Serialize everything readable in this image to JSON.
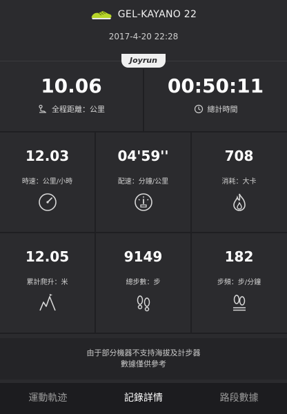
{
  "header": {
    "title": "GEL-KAYANO 22",
    "date": "2017-4-20 22:28",
    "brand": "Joyrun"
  },
  "summary": {
    "distance": {
      "value": "10.06",
      "label": "全程距離：公里"
    },
    "duration": {
      "value": "00:50:11",
      "label": "總計時間"
    }
  },
  "stats_row1": [
    {
      "value": "12.03",
      "label": "時速：公里/小時",
      "icon": "speedometer-icon"
    },
    {
      "value": "04'59''",
      "label": "配速：分鐘/公里",
      "icon": "pace-gauge-icon"
    },
    {
      "value": "708",
      "label": "消耗：大卡",
      "icon": "flame-icon"
    }
  ],
  "stats_row2": [
    {
      "value": "12.05",
      "label": "累計爬升：米",
      "icon": "climb-icon"
    },
    {
      "value": "9149",
      "label": "總步數：步",
      "icon": "footprints-icon"
    },
    {
      "value": "182",
      "label": "步頻：步/分鐘",
      "icon": "cadence-icon"
    }
  ],
  "note": {
    "line1": "由于部分機器不支持海拔及計步器",
    "line2": "數據僅供參考"
  },
  "tabs": [
    {
      "label": "運動軌迹",
      "active": false
    },
    {
      "label": "記錄詳情",
      "active": true
    },
    {
      "label": "路段數據",
      "active": false
    }
  ],
  "colors": {
    "background": "#2b2b2e",
    "accent_shoe": "#b8d62a"
  }
}
